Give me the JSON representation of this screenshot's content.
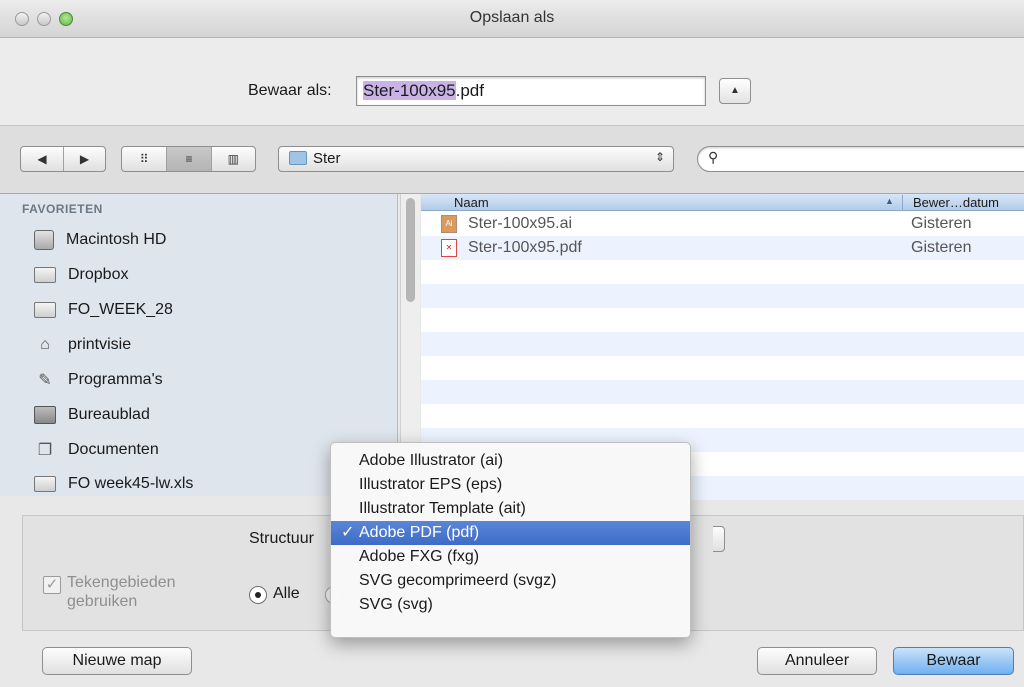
{
  "window": {
    "title": "Opslaan als"
  },
  "save": {
    "label": "Bewaar als:",
    "filename_selected": "Ster-100x95",
    "filename_ext": ".pdf",
    "expand_glyph": "▲"
  },
  "toolbar": {
    "back_glyph": "◀",
    "forward_glyph": "▶",
    "view_icons_glyph": "⠿",
    "view_list_glyph": "≡",
    "view_columns_glyph": "▥",
    "path_folder": "Ster",
    "path_updown_glyph": "⇕",
    "search_glyph": "⚲",
    "search_value": ""
  },
  "sidebar": {
    "heading": "FAVORIETEN",
    "items": [
      {
        "label": "Macintosh HD",
        "icon": "hard-drive-icon"
      },
      {
        "label": "Dropbox",
        "icon": "folder-icon"
      },
      {
        "label": "FO_WEEK_28",
        "icon": "folder-icon"
      },
      {
        "label": "printvisie",
        "icon": "home-icon"
      },
      {
        "label": "Programma's",
        "icon": "applications-icon"
      },
      {
        "label": "Bureaublad",
        "icon": "desktop-icon"
      },
      {
        "label": "Documenten",
        "icon": "documents-icon"
      },
      {
        "label": "FO week45-lw.xls",
        "icon": "folder-icon"
      }
    ]
  },
  "filelist": {
    "columns": {
      "name": "Naam",
      "sort_glyph": "▲",
      "date": "Bewer…datum"
    },
    "rows": [
      {
        "name": "Ster-100x95.ai",
        "date": "Gisteren",
        "type": "ai"
      },
      {
        "name": "Ster-100x95.pdf",
        "date": "Gisteren",
        "type": "pdf"
      }
    ]
  },
  "options": {
    "structure_label": "Structuur",
    "artboards_label_1": "Tekengebieden",
    "artboards_label_2": "gebruiken",
    "check_glyph": "✓",
    "radio_all_label": "Alle"
  },
  "format_menu": {
    "check_glyph": "✓",
    "selected_index": 3,
    "items": [
      "Adobe Illustrator (ai)",
      "Illustrator EPS (eps)",
      "Illustrator Template (ait)",
      "Adobe PDF (pdf)",
      "Adobe FXG (fxg)",
      "SVG gecomprimeerd (svgz)",
      "SVG (svg)"
    ]
  },
  "buttons": {
    "new_folder": "Nieuwe map",
    "cancel": "Annuleer",
    "save": "Bewaar"
  },
  "colors": {
    "selection_highlight": "#c9b2e6",
    "menu_selected": "#3d6cc8",
    "default_button": "#6fb0f1",
    "sidebar_bg": "#dfe5ec"
  }
}
